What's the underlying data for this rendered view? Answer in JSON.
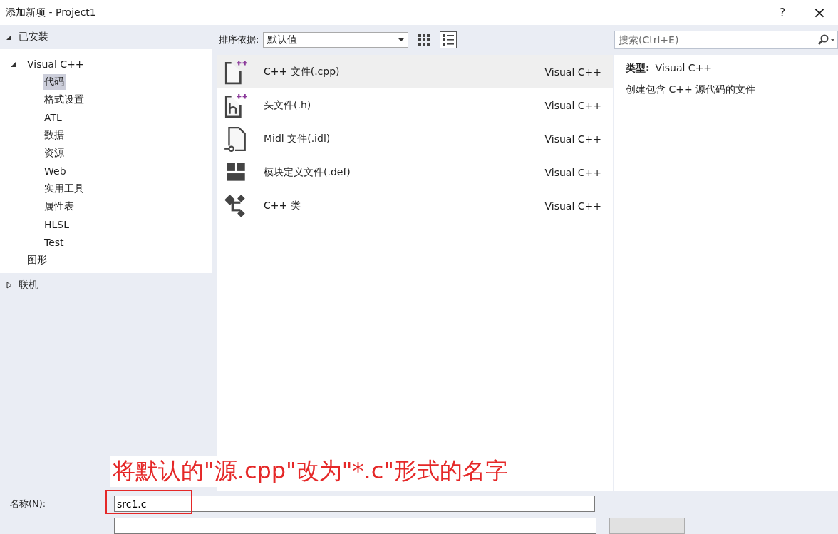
{
  "window": {
    "title": "添加新项 - Project1",
    "help": "?",
    "close": "×"
  },
  "installed": {
    "label": "已安装",
    "expanded": true
  },
  "tree": [
    {
      "label": "Visual C++",
      "expanded": true,
      "selected": false,
      "children": [
        {
          "label": "代码",
          "selected": true
        },
        {
          "label": "格式设置",
          "selected": false
        },
        {
          "label": "ATL",
          "selected": false
        },
        {
          "label": "数据",
          "selected": false
        },
        {
          "label": "资源",
          "selected": false
        },
        {
          "label": "Web",
          "selected": false
        },
        {
          "label": "实用工具",
          "selected": false
        },
        {
          "label": "属性表",
          "selected": false
        },
        {
          "label": "HLSL",
          "selected": false
        },
        {
          "label": "Test",
          "selected": false
        }
      ]
    },
    {
      "label": "图形",
      "selected": false
    }
  ],
  "online": {
    "label": "联机",
    "expanded": false
  },
  "sort": {
    "label": "排序依据:",
    "value": "默认值"
  },
  "views": [
    {
      "kind": "grid",
      "selected": false
    },
    {
      "kind": "list",
      "selected": true
    }
  ],
  "templates": [
    {
      "kind": "cpp",
      "name": "C++ 文件(.cpp)",
      "type": "Visual C++",
      "selected": true
    },
    {
      "kind": "header",
      "name": "头文件(.h)",
      "type": "Visual C++",
      "selected": false
    },
    {
      "kind": "idl",
      "name": "Midl 文件(.idl)",
      "type": "Visual C++",
      "selected": false
    },
    {
      "kind": "def",
      "name": "模块定义文件(.def)",
      "type": "Visual C++",
      "selected": false
    },
    {
      "kind": "class",
      "name": "C++ 类",
      "type": "Visual C++",
      "selected": false
    }
  ],
  "search": {
    "placeholder": "搜索(Ctrl+E)"
  },
  "details": {
    "type_label": "类型:",
    "type_value": "Visual C++",
    "description": "创建包含 C++ 源代码的文件"
  },
  "annotation": {
    "text": "将默认的\"源.cpp\"改为\"*.c\"形式的名字"
  },
  "name_field": {
    "label": "名称(N):",
    "value": "src1.c",
    "highlighted": true
  }
}
